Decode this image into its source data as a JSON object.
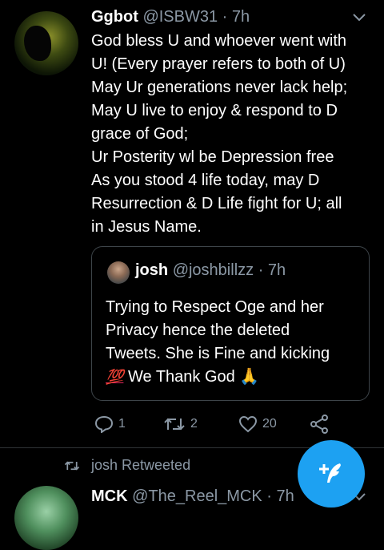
{
  "tweet": {
    "display_name": "Ggbot",
    "handle": "@ISBW31",
    "time": "7h",
    "body_lines": [
      "God bless U and whoever went with",
      "U! (Every prayer refers to both of U)",
      "May Ur generations never lack help;",
      "May U live to enjoy & respond to D",
      "grace of God;",
      "Ur Posterity wl be Depression free",
      "As you stood 4 life today, may D",
      "Resurrection & D Life fight for U;  all",
      "in Jesus Name."
    ],
    "quoted": {
      "display_name": "josh",
      "handle": "@joshbillzz",
      "time": "7h",
      "lines": [
        "Trying to Respect Oge and her",
        "Privacy hence the deleted",
        "Tweets. She is Fine and kicking"
      ],
      "last_line_emoji": "💯",
      "last_line_text": "We Thank God",
      "last_line_end_emoji": "🙏"
    },
    "actions": {
      "replies": "1",
      "retweets": "2",
      "likes": "20"
    }
  },
  "next_tweet": {
    "retweet_label": "josh Retweeted",
    "display_name": "MCK",
    "handle": "@The_Reel_MCK",
    "time": "7h"
  },
  "icons": {
    "chevron": "chevron-down-icon",
    "reply": "reply-icon",
    "retweet": "retweet-icon",
    "like": "heart-icon",
    "share": "share-icon",
    "compose": "compose-feather-icon"
  },
  "colors": {
    "background": "#000000",
    "secondary_text": "#8b98a5",
    "accent": "#1da1f2",
    "border": "#3d4449"
  }
}
